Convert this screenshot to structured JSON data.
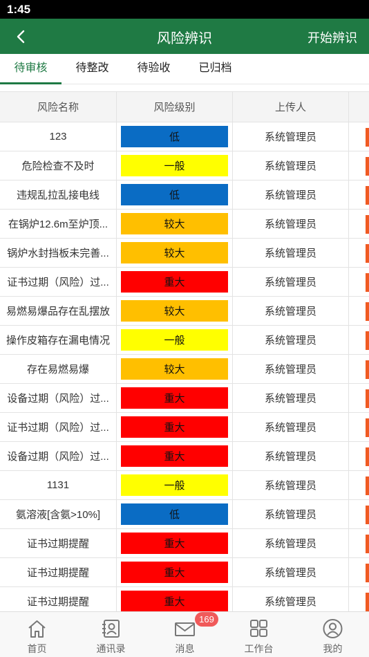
{
  "status_bar": {
    "time": "1:45"
  },
  "header": {
    "title": "风险辨识",
    "action": "开始辨识",
    "back_icon": "chevron-left-icon"
  },
  "tabs": [
    {
      "label": "待审核",
      "active": true
    },
    {
      "label": "待整改",
      "active": false
    },
    {
      "label": "待验收",
      "active": false
    },
    {
      "label": "已归档",
      "active": false
    }
  ],
  "table": {
    "columns": [
      "风险名称",
      "风险级别",
      "上传人",
      ""
    ],
    "level_colors": {
      "低": "#0a6cc4",
      "一般": "#ffff00",
      "较大": "#ffbf00",
      "重大": "#ff0000"
    },
    "rows": [
      {
        "name": "123",
        "level": "低",
        "uploader": "系统管理员"
      },
      {
        "name": "危险检查不及时",
        "level": "一般",
        "uploader": "系统管理员"
      },
      {
        "name": "违规乱拉乱接电线",
        "level": "低",
        "uploader": "系统管理员"
      },
      {
        "name": "在锅炉12.6m至炉顶...",
        "level": "较大",
        "uploader": "系统管理员"
      },
      {
        "name": "锅炉水封挡板未完善...",
        "level": "较大",
        "uploader": "系统管理员"
      },
      {
        "name": "证书过期（风险）过...",
        "level": "重大",
        "uploader": "系统管理员"
      },
      {
        "name": "易燃易爆品存在乱摆放",
        "level": "较大",
        "uploader": "系统管理员"
      },
      {
        "name": "操作皮箱存在漏电情况",
        "level": "一般",
        "uploader": "系统管理员"
      },
      {
        "name": "存在易燃易爆",
        "level": "较大",
        "uploader": "系统管理员"
      },
      {
        "name": "设备过期（风险）过...",
        "level": "重大",
        "uploader": "系统管理员"
      },
      {
        "name": "证书过期（风险）过...",
        "level": "重大",
        "uploader": "系统管理员"
      },
      {
        "name": "设备过期（风险）过...",
        "level": "重大",
        "uploader": "系统管理员"
      },
      {
        "name": "1131",
        "level": "一般",
        "uploader": "系统管理员"
      },
      {
        "name": "氨溶液[含氨>10%]",
        "level": "低",
        "uploader": "系统管理员"
      },
      {
        "name": "证书过期提醒",
        "level": "重大",
        "uploader": "系统管理员"
      },
      {
        "name": "证书过期提醒",
        "level": "重大",
        "uploader": "系统管理员"
      },
      {
        "name": "证书过期提醒",
        "level": "重大",
        "uploader": "系统管理员"
      }
    ]
  },
  "bottom_nav": {
    "items": [
      {
        "label": "首页",
        "icon": "home-icon"
      },
      {
        "label": "通讯录",
        "icon": "contacts-icon"
      },
      {
        "label": "消息",
        "icon": "mail-icon"
      },
      {
        "label": "工作台",
        "icon": "grid-icon"
      },
      {
        "label": "我的",
        "icon": "user-icon"
      }
    ],
    "message_badge": "169"
  },
  "colors": {
    "brand": "#1f7a44",
    "accent_edge": "#f05a22",
    "badge": "#f05a5a"
  }
}
